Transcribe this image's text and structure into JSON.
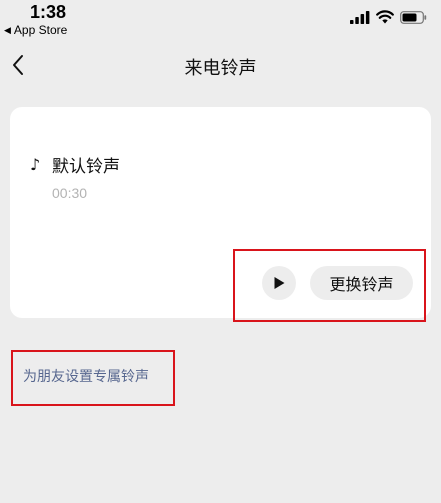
{
  "status_bar": {
    "time": "1:38",
    "back_app_label": "App Store",
    "back_app_icon": "triangle-left-icon",
    "icons": [
      "cellular-signal-icon",
      "wifi-icon",
      "battery-icon"
    ]
  },
  "nav": {
    "title": "来电铃声",
    "back_icon": "chevron-left-icon"
  },
  "ringtone": {
    "icon": "music-note-icon",
    "name": "默认铃声",
    "duration": "00:30"
  },
  "actions": {
    "play_icon": "play-icon",
    "change_label": "更换铃声"
  },
  "friend_link": "为朋友设置专属铃声",
  "colors": {
    "background": "#ededed",
    "card": "#ffffff",
    "link": "#57678f",
    "highlight": "#d9141b",
    "muted_text": "#b3b3b3"
  }
}
